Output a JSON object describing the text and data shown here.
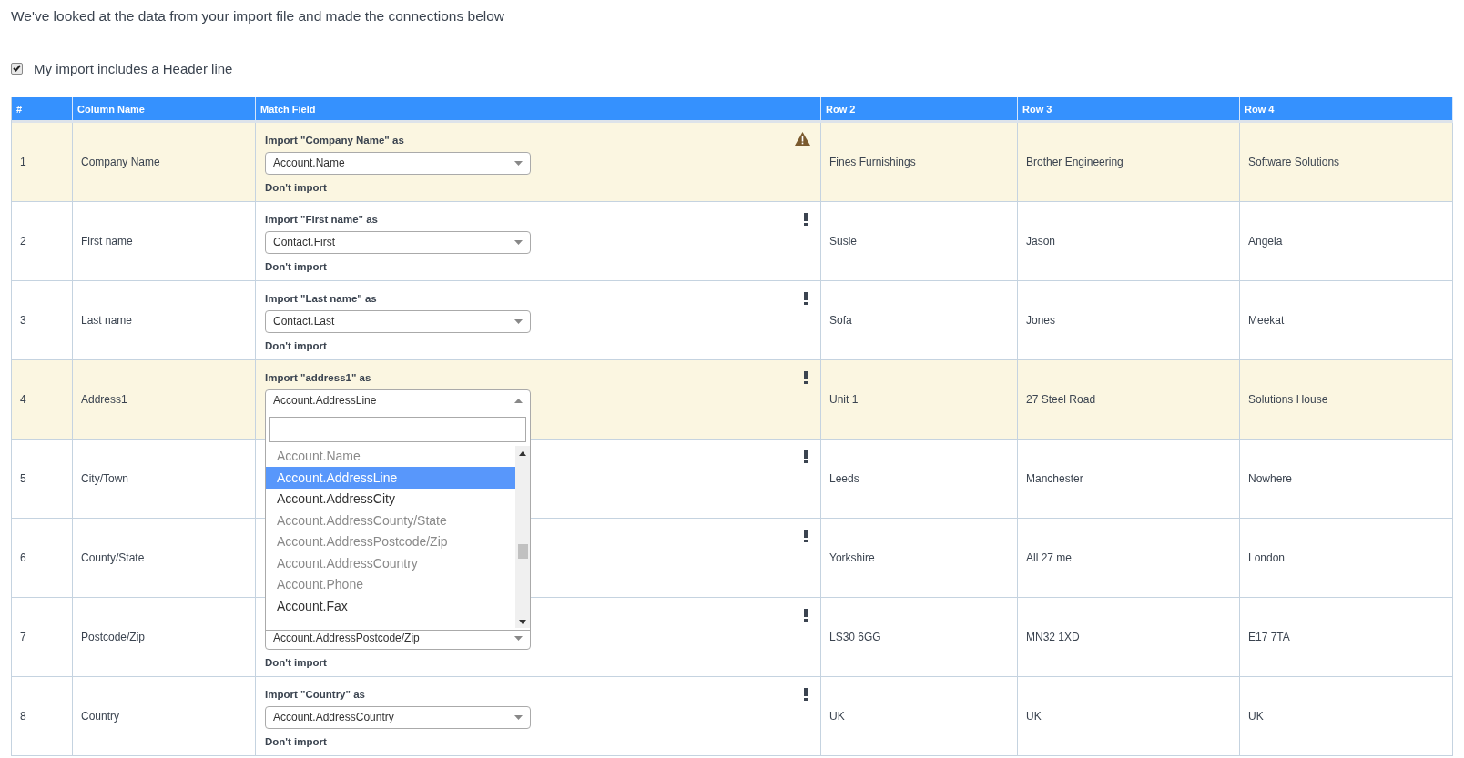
{
  "intro": "We've looked at the data from your import file and made the connections below",
  "header_option": {
    "label": "My import includes a Header line",
    "checked": true
  },
  "table": {
    "columns": [
      "#",
      "Column Name",
      "Match Field",
      "Row 2",
      "Row 3",
      "Row 4"
    ],
    "rows": [
      {
        "number": "1",
        "column_name": "Company Name",
        "highlighted": true,
        "kind": "warning",
        "match": {
          "label": "Import \"Company Name\" as",
          "value": "Account.Name",
          "open": false,
          "skip": "Don't import"
        },
        "cells": [
          "Fines Furnishings",
          "Brother Engineering",
          "Software Solutions"
        ]
      },
      {
        "number": "2",
        "column_name": "First name",
        "highlighted": false,
        "kind": "notice",
        "match": {
          "label": "Import \"First name\" as",
          "value": "Contact.First",
          "open": false,
          "skip": "Don't import"
        },
        "cells": [
          "Susie",
          "Jason",
          "Angela"
        ]
      },
      {
        "number": "3",
        "column_name": "Last name",
        "highlighted": false,
        "kind": "notice",
        "match": {
          "label": "Import \"Last name\" as",
          "value": "Contact.Last",
          "open": false,
          "skip": "Don't import"
        },
        "cells": [
          "Sofa",
          "Jones",
          "Meekat"
        ]
      },
      {
        "number": "4",
        "column_name": "Address1",
        "highlighted": true,
        "kind": "notice",
        "match": {
          "label": "Import \"address1\" as",
          "value": "Account.AddressLine",
          "open": true,
          "dropdown": {
            "options": [
              {
                "label": "Account.Name",
                "selected": false,
                "disabled": true
              },
              {
                "label": "Account.AddressLine",
                "selected": true,
                "disabled": false
              },
              {
                "label": "Account.AddressCity",
                "selected": false,
                "disabled": false
              },
              {
                "label": "Account.AddressCounty/State",
                "selected": false,
                "disabled": true
              },
              {
                "label": "Account.AddressPostcode/Zip",
                "selected": false,
                "disabled": true
              },
              {
                "label": "Account.AddressCountry",
                "selected": false,
                "disabled": true
              },
              {
                "label": "Account.Phone",
                "selected": false,
                "disabled": true
              },
              {
                "label": "Account.Fax",
                "selected": false,
                "disabled": false
              }
            ]
          }
        },
        "cells": [
          "Unit 1",
          "27 Steel Road",
          "Solutions House"
        ]
      },
      {
        "number": "5",
        "column_name": "City/Town",
        "highlighted": false,
        "kind": "notice",
        "match": {},
        "cells": [
          "Leeds",
          "Manchester",
          "Nowhere"
        ]
      },
      {
        "number": "6",
        "column_name": "County/State",
        "highlighted": false,
        "kind": "notice",
        "match": {},
        "cells": [
          "Yorkshire",
          "All 27 me",
          "London"
        ]
      },
      {
        "number": "7",
        "column_name": "Postcode/Zip",
        "highlighted": false,
        "kind": "notice",
        "match": {
          "value": "Account.AddressPostcode/Zip",
          "open": false,
          "skip": "Don't import"
        },
        "cells": [
          "LS30 6GG",
          "MN32 1XD",
          "E17 7TA"
        ]
      },
      {
        "number": "8",
        "column_name": "Country",
        "highlighted": false,
        "kind": "notice",
        "match": {
          "label": "Import \"Country\" as",
          "value": "Account.AddressCountry",
          "open": false,
          "skip": "Don't import"
        },
        "cells": [
          "UK",
          "UK",
          "UK"
        ]
      }
    ]
  }
}
